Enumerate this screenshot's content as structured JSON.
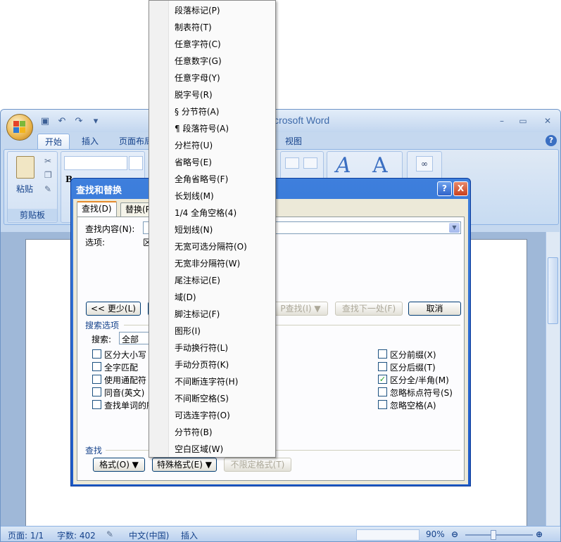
{
  "word": {
    "title": "icrosoft Word",
    "tabs": [
      "开始",
      "插入",
      "页面布局",
      "视图"
    ],
    "clipboard": {
      "paste_label": "粘贴",
      "group_label": "剪贴板"
    },
    "status": {
      "page": "页面: 1/1",
      "words": "字数: 402",
      "language": "中文(中国)",
      "mode": "插入",
      "zoom": "90%"
    }
  },
  "dialog": {
    "title": "查找和替换",
    "help": "?",
    "close": "X",
    "tabs": {
      "find": "查找(D)",
      "replace": "替换(P"
    },
    "find_label": "查找内容(N):",
    "options_label": "选项:",
    "options_value": "区",
    "less_button": "<< 更少(L)",
    "find_in_button": "P查找(I) ▼",
    "find_next_button": "查找下一处(F)",
    "cancel_button": "取消",
    "search_options_label": "搜索选项",
    "search_label": "搜索:",
    "search_value": "全部",
    "left_checks": [
      {
        "label": "区分大小写",
        "checked": false
      },
      {
        "label": "全字匹配",
        "checked": false
      },
      {
        "label": "使用通配符",
        "checked": false
      },
      {
        "label": "同音(英文)",
        "checked": false
      },
      {
        "label": "查找单词的所",
        "checked": false
      }
    ],
    "right_checks": [
      {
        "label": "区分前缀(X)",
        "checked": false
      },
      {
        "label": "区分后缀(T)",
        "checked": false
      },
      {
        "label": "区分全/半角(M)",
        "checked": true
      },
      {
        "label": "忽略标点符号(S)",
        "checked": false
      },
      {
        "label": "忽略空格(A)",
        "checked": false
      }
    ],
    "find_section_label": "查找",
    "format_button": "格式(O) ▼",
    "special_button": "特殊格式(E) ▼",
    "no_format_button": "不限定格式(T)"
  },
  "menu": {
    "items": [
      "段落标记(P)",
      "制表符(T)",
      "任意字符(C)",
      "任意数字(G)",
      "任意字母(Y)",
      "脱字号(R)",
      "§ 分节符(A)",
      "¶ 段落符号(A)",
      "分栏符(U)",
      "省略号(E)",
      "全角省略号(F)",
      "长划线(M)",
      "1/4 全角空格(4)",
      "短划线(N)",
      "无宽可选分隔符(O)",
      "无宽非分隔符(W)",
      "尾注标记(E)",
      "域(D)",
      "脚注标记(F)",
      "图形(I)",
      "手动换行符(L)",
      "手动分页符(K)",
      "不间断连字符(H)",
      "不间断空格(S)",
      "可选连字符(O)",
      "分节符(B)",
      "空白区域(W)"
    ]
  }
}
